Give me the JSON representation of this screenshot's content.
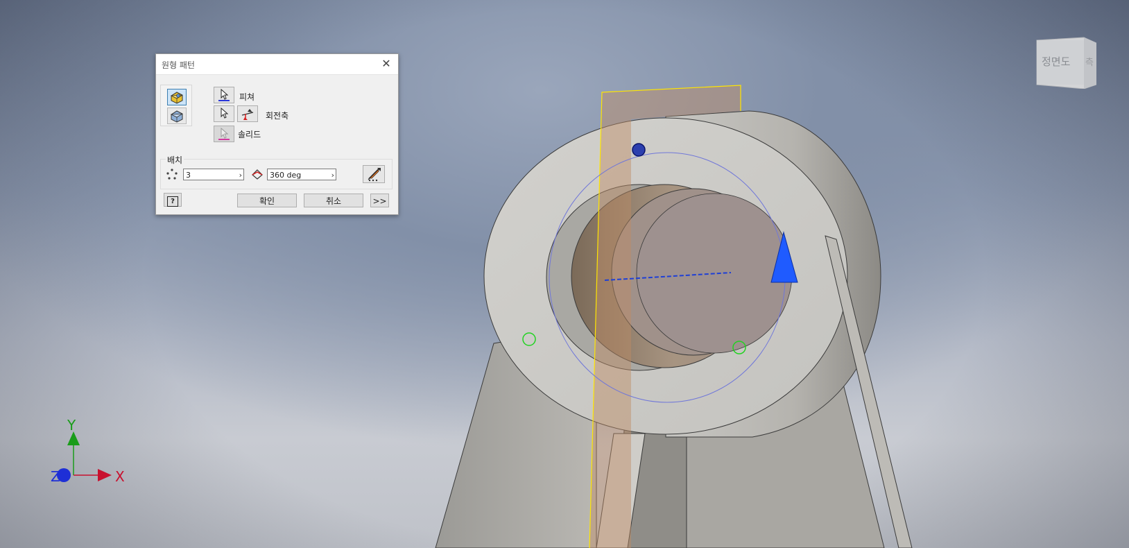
{
  "dialog": {
    "title": "원형 패턴",
    "close_icon": "close-icon",
    "feature_label": "피쳐",
    "axis_label": "회전축",
    "solid_label": "솔리드",
    "placement_label": "배치",
    "count_value": "3",
    "angle_value": "360 deg",
    "ok_label": "확인",
    "cancel_label": "취소",
    "more_label": ">>",
    "help_icon": "help-icon"
  },
  "viewcube": {
    "front_label": "정면도",
    "side_label": "측"
  },
  "triad": {
    "x_label": "X",
    "y_label": "Y",
    "z_label": "Z"
  },
  "colors": {
    "x_axis": "#c8102e",
    "y_axis": "#1a9c1a",
    "z_axis": "#1e2fd6",
    "selection_yellow": "#ffe600",
    "arrow_blue": "#1f5bff",
    "marker_green": "#21d321"
  }
}
